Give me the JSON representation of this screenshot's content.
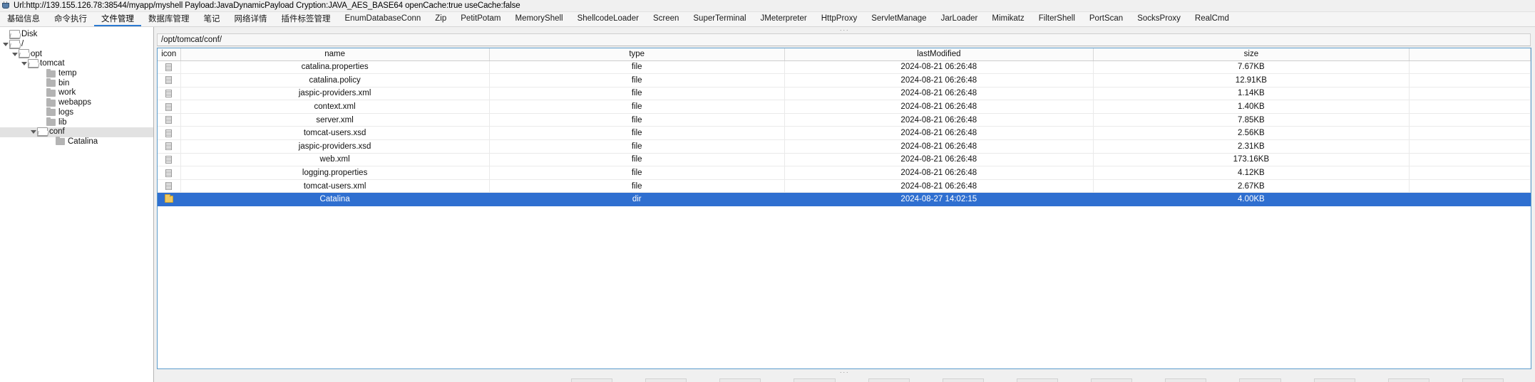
{
  "window": {
    "icon": "java-cup-icon",
    "title": "Url:http://139.155.126.78:38544/myapp/myshell Payload:JavaDynamicPayload Cryption:JAVA_AES_BASE64 openCache:true useCache:false"
  },
  "tabs": [
    {
      "label": "基础信息",
      "active": false
    },
    {
      "label": "命令执行",
      "active": false
    },
    {
      "label": "文件管理",
      "active": true
    },
    {
      "label": "数据库管理",
      "active": false
    },
    {
      "label": "笔记",
      "active": false
    },
    {
      "label": "网络详情",
      "active": false
    },
    {
      "label": "插件标签管理",
      "active": false
    },
    {
      "label": "EnumDatabaseConn",
      "active": false
    },
    {
      "label": "Zip",
      "active": false
    },
    {
      "label": "PetitPotam",
      "active": false
    },
    {
      "label": "MemoryShell",
      "active": false
    },
    {
      "label": "ShellcodeLoader",
      "active": false
    },
    {
      "label": "Screen",
      "active": false
    },
    {
      "label": "SuperTerminal",
      "active": false
    },
    {
      "label": "JMeterpreter",
      "active": false
    },
    {
      "label": "HttpProxy",
      "active": false
    },
    {
      "label": "ServletManage",
      "active": false
    },
    {
      "label": "JarLoader",
      "active": false
    },
    {
      "label": "Mimikatz",
      "active": false
    },
    {
      "label": "FilterShell",
      "active": false
    },
    {
      "label": "PortScan",
      "active": false
    },
    {
      "label": "SocksProxy",
      "active": false
    },
    {
      "label": "RealCmd",
      "active": false
    }
  ],
  "sidebar": {
    "tree": [
      {
        "label": "Disk",
        "depth": 0,
        "twisty": "none",
        "icon": "folder-open-icon",
        "selected": false
      },
      {
        "label": "/",
        "depth": 0,
        "twisty": "open",
        "icon": "folder-open-icon",
        "selected": false
      },
      {
        "label": "opt",
        "depth": 1,
        "twisty": "open",
        "icon": "folder-open-icon",
        "selected": false
      },
      {
        "label": "tomcat",
        "depth": 2,
        "twisty": "open",
        "icon": "folder-open-icon",
        "selected": false
      },
      {
        "label": "temp",
        "depth": 4,
        "twisty": "none",
        "icon": "folder-closed-icon",
        "selected": false
      },
      {
        "label": "bin",
        "depth": 4,
        "twisty": "none",
        "icon": "folder-closed-icon",
        "selected": false
      },
      {
        "label": "work",
        "depth": 4,
        "twisty": "none",
        "icon": "folder-closed-icon",
        "selected": false
      },
      {
        "label": "webapps",
        "depth": 4,
        "twisty": "none",
        "icon": "folder-closed-icon",
        "selected": false
      },
      {
        "label": "logs",
        "depth": 4,
        "twisty": "none",
        "icon": "folder-closed-icon",
        "selected": false
      },
      {
        "label": "lib",
        "depth": 4,
        "twisty": "none",
        "icon": "folder-closed-icon",
        "selected": false
      },
      {
        "label": "conf",
        "depth": 3,
        "twisty": "open",
        "icon": "folder-open-icon",
        "selected": true
      },
      {
        "label": "Catalina",
        "depth": 5,
        "twisty": "none",
        "icon": "folder-closed-icon",
        "selected": false
      }
    ]
  },
  "path": {
    "value": "/opt/tomcat/conf/"
  },
  "table": {
    "columns": [
      "icon",
      "name",
      "type",
      "lastModified",
      "size"
    ],
    "rows": [
      {
        "icon": "file-icon",
        "name": "catalina.properties",
        "type": "file",
        "lastModified": "2024-08-21 06:26:48",
        "size": "7.67KB",
        "selected": false
      },
      {
        "icon": "file-icon",
        "name": "catalina.policy",
        "type": "file",
        "lastModified": "2024-08-21 06:26:48",
        "size": "12.91KB",
        "selected": false
      },
      {
        "icon": "file-icon",
        "name": "jaspic-providers.xml",
        "type": "file",
        "lastModified": "2024-08-21 06:26:48",
        "size": "1.14KB",
        "selected": false
      },
      {
        "icon": "file-icon",
        "name": "context.xml",
        "type": "file",
        "lastModified": "2024-08-21 06:26:48",
        "size": "1.40KB",
        "selected": false
      },
      {
        "icon": "file-icon",
        "name": "server.xml",
        "type": "file",
        "lastModified": "2024-08-21 06:26:48",
        "size": "7.85KB",
        "selected": false
      },
      {
        "icon": "file-icon",
        "name": "tomcat-users.xsd",
        "type": "file",
        "lastModified": "2024-08-21 06:26:48",
        "size": "2.56KB",
        "selected": false
      },
      {
        "icon": "file-icon",
        "name": "jaspic-providers.xsd",
        "type": "file",
        "lastModified": "2024-08-21 06:26:48",
        "size": "2.31KB",
        "selected": false
      },
      {
        "icon": "file-icon",
        "name": "web.xml",
        "type": "file",
        "lastModified": "2024-08-21 06:26:48",
        "size": "173.16KB",
        "selected": false
      },
      {
        "icon": "file-icon",
        "name": "logging.properties",
        "type": "file",
        "lastModified": "2024-08-21 06:26:48",
        "size": "4.12KB",
        "selected": false
      },
      {
        "icon": "file-icon",
        "name": "tomcat-users.xml",
        "type": "file",
        "lastModified": "2024-08-21 06:26:48",
        "size": "2.67KB",
        "selected": false
      },
      {
        "icon": "folder-icon",
        "name": "Catalina",
        "type": "dir",
        "lastModified": "2024-08-27 14:02:15",
        "size": "4.00KB",
        "selected": true
      }
    ]
  },
  "splitters": {
    "top_grip": "···",
    "bottom_grip": "···"
  }
}
